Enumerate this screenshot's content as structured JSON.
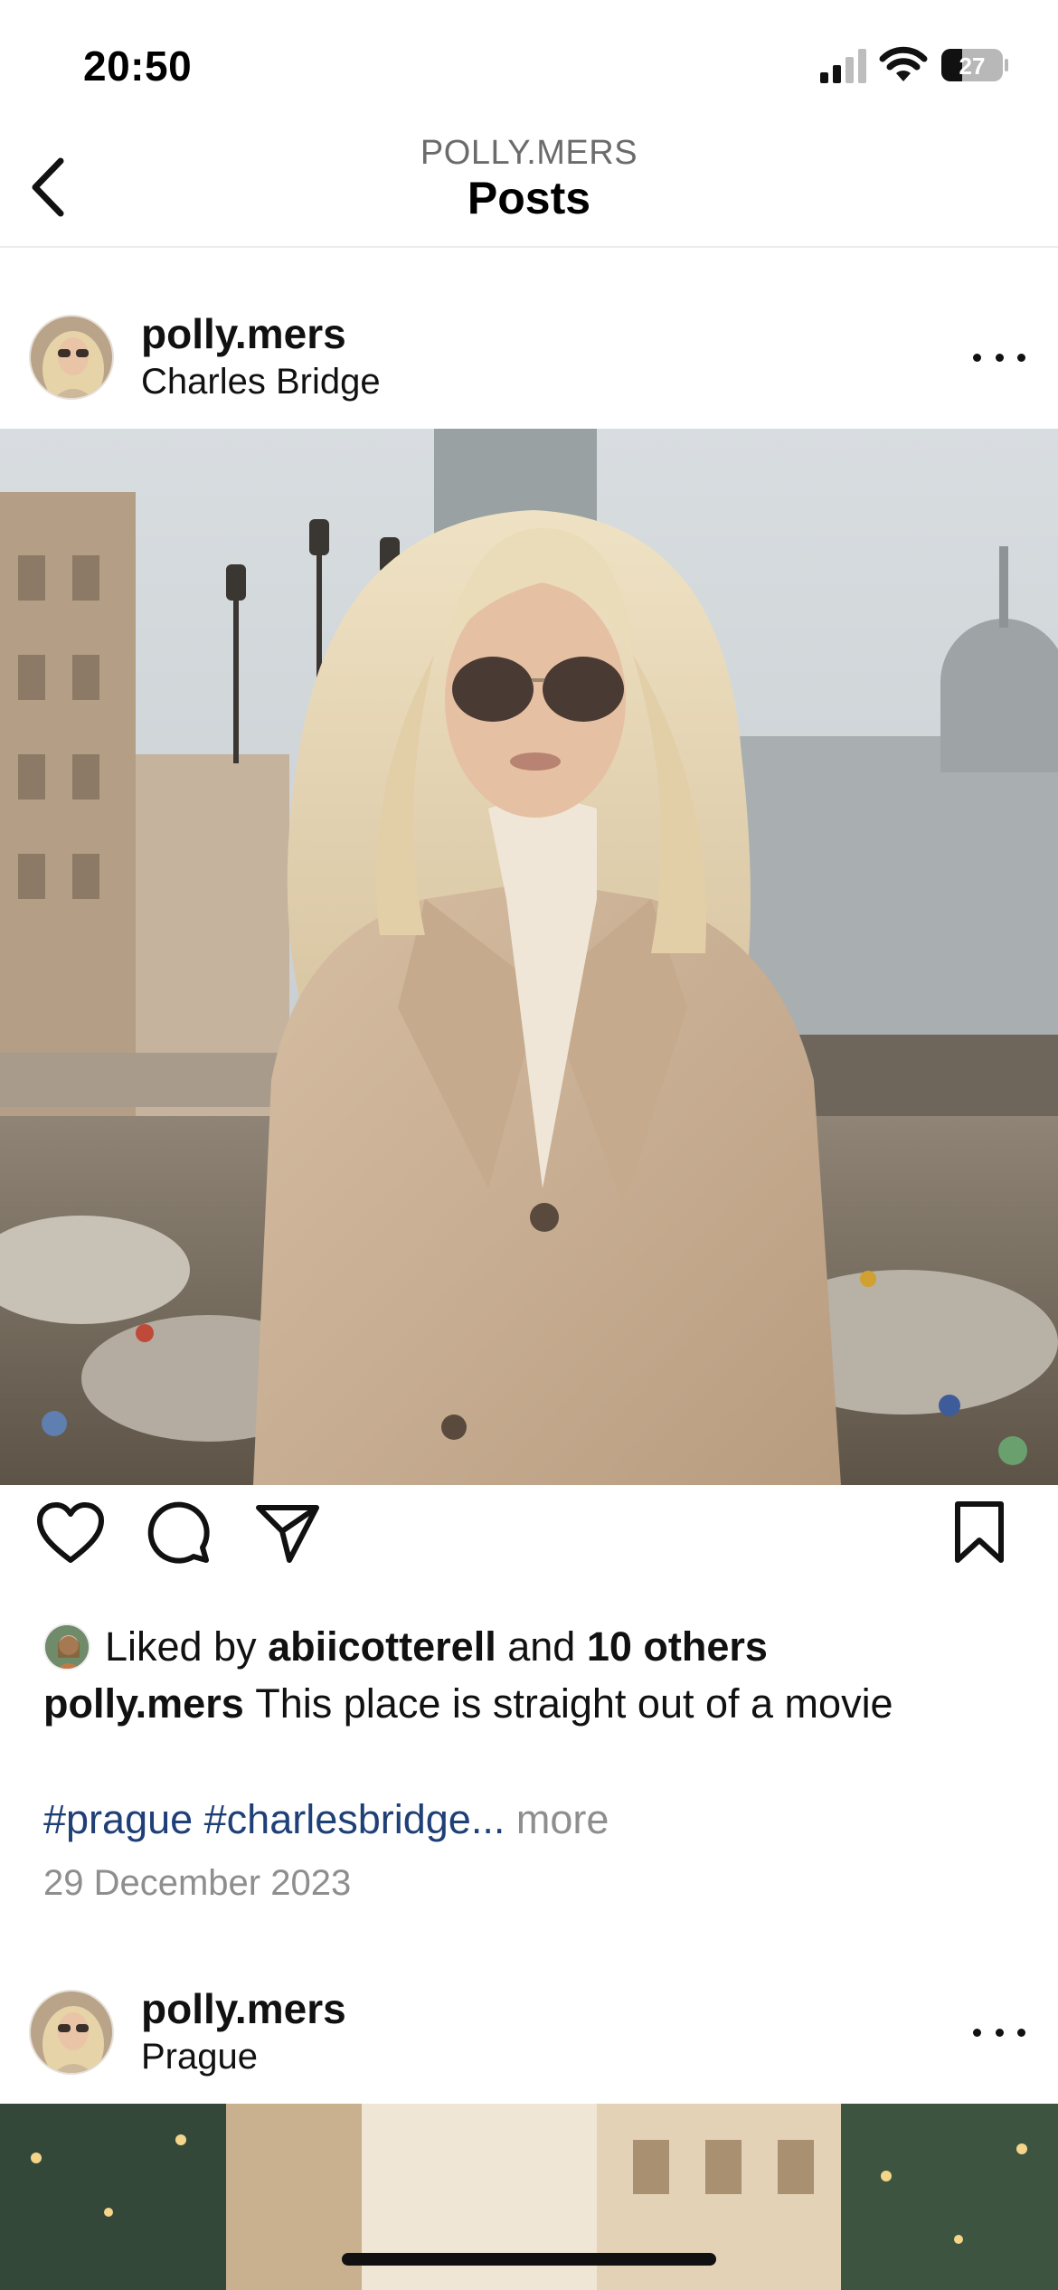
{
  "status_bar": {
    "time": "20:50",
    "battery_level": "27",
    "icons": [
      "signal-icon",
      "wifi-icon",
      "battery-icon"
    ]
  },
  "header": {
    "subtitle": "POLLY.MERS",
    "title": "Posts",
    "back_icon": "chevron-left-icon"
  },
  "posts": [
    {
      "username": "polly.mers",
      "location": "Charles Bridge",
      "image": "photo of a blonde woman in sunglasses and a beige coat standing on a bridge in a city",
      "actions": [
        "heart-icon",
        "comment-icon",
        "share-icon",
        "bookmark-icon"
      ],
      "likes": {
        "prefix": "Liked by",
        "user": "abiicotterell",
        "connector": "and",
        "others": "10 others"
      },
      "caption": {
        "username": "polly.mers",
        "text": "This place is straight out of a movie"
      },
      "hashtags": "#prague #charlesbridge",
      "ellipsis": "...",
      "more_label": "more",
      "date": "29 December 2023"
    },
    {
      "username": "polly.mers",
      "location": "Prague"
    }
  ],
  "colors": {
    "hashtag": "#1f3f77",
    "muted": "#8e8e8e",
    "text": "#111111"
  }
}
